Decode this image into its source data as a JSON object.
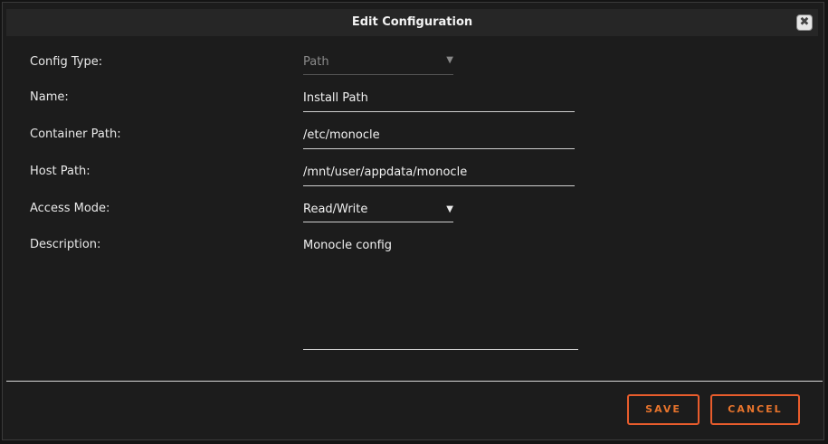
{
  "dialog": {
    "title": "Edit Configuration",
    "close_symbol": "✖",
    "close_icon": "close-icon"
  },
  "form": {
    "config_type": {
      "label": "Config Type:",
      "value": "Path",
      "caret": "▼"
    },
    "name": {
      "label": "Name:",
      "value": "Install Path"
    },
    "container_path": {
      "label": "Container Path:",
      "value": "/etc/monocle"
    },
    "host_path": {
      "label": "Host Path:",
      "value": "/mnt/user/appdata/monocle"
    },
    "access_mode": {
      "label": "Access Mode:",
      "value": "Read/Write",
      "caret": "▼"
    },
    "description": {
      "label": "Description:",
      "value": "Monocle config"
    }
  },
  "buttons": {
    "save_label": "SAVE",
    "cancel_label": "CANCEL"
  },
  "colors": {
    "accent": "#e85c2c",
    "background": "#1c1c1c",
    "titlebar": "#262626"
  }
}
